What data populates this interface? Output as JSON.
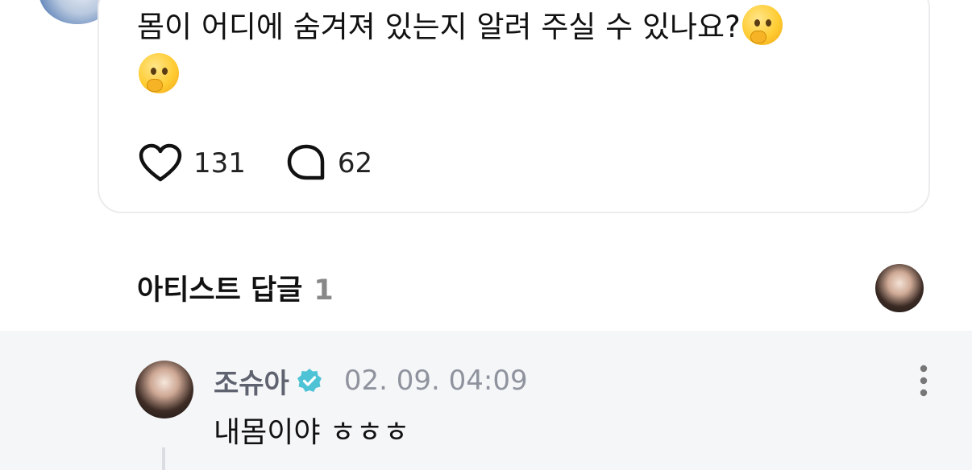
{
  "post": {
    "text": "몸이 어디에 숨겨져 있는지 알려 주실 수 있나요?",
    "emoji": "thinking-face",
    "likes": "131",
    "comments": "62"
  },
  "replies_section": {
    "title": "아티스트 답글",
    "count": "1"
  },
  "reply": {
    "author": "조슈아",
    "verified": true,
    "timestamp": "02. 09. 04:09",
    "text": "내몸이야 ㅎㅎㅎ"
  },
  "colors": {
    "verified_badge": "#4fc3d6",
    "comment_background": "#f5f6f8",
    "muted_text": "#8f939e"
  }
}
